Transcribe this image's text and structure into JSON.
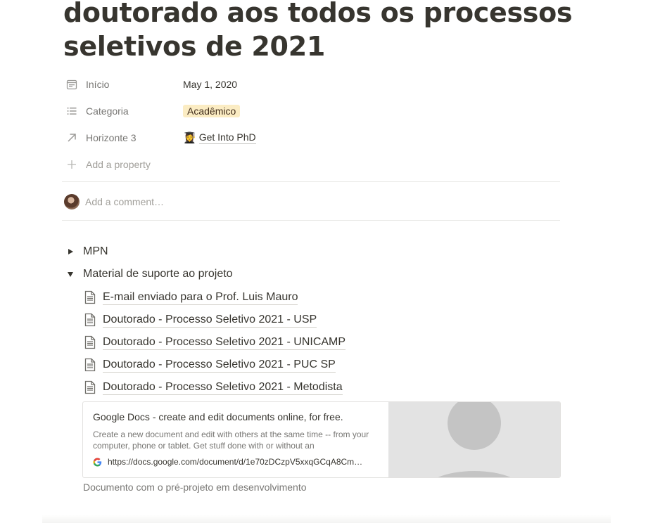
{
  "page": {
    "title": "doutorado aos todos os processos seletivos de 2021"
  },
  "properties": [
    {
      "icon": "calendar-icon",
      "key": "Início",
      "value": "May 1, 2020"
    },
    {
      "icon": "list-icon",
      "key": "Categoria",
      "value": "Acadêmico",
      "tag_color": "#fbecc3"
    },
    {
      "icon": "arrow-up-right-icon",
      "key": "Horizonte 3",
      "emoji": "👩‍🎓",
      "value": "Get Into PhD"
    }
  ],
  "add_property": "Add a property",
  "comment": {
    "placeholder": "Add a comment…"
  },
  "toggles": [
    {
      "label": "MPN",
      "expanded": false
    },
    {
      "label": "Material de suporte ao projeto",
      "expanded": true
    }
  ],
  "pages": [
    "E-mail enviado para o Prof. Luis Mauro",
    "Doutorado - Processo Seletivo 2021 - USP",
    "Doutorado - Processo Seletivo 2021 - UNICAMP",
    "Doutorado - Processo Seletivo 2021 - PUC SP",
    "Doutorado - Processo Seletivo 2021 - Metodista"
  ],
  "bookmark": {
    "title": "Google Docs - create and edit documents online, for free.",
    "description": "Create a new document and edit with others at the same time -- from your computer, phone or tablet. Get stuff done with or without an",
    "url": "https://docs.google.com/document/d/1e70zDCzpV5xxqGCqA8Cm…"
  },
  "caption": "Documento com o pré-projeto em desenvolvimento"
}
